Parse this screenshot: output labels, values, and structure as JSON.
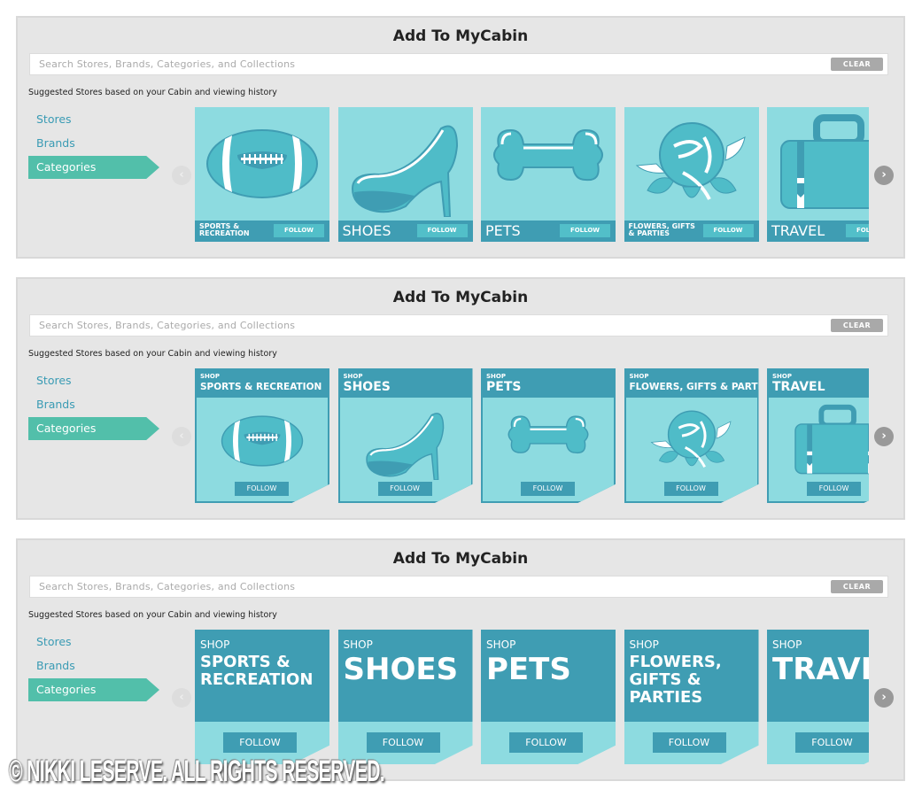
{
  "panels": [
    {
      "title": "Add To MyCabin",
      "search_placeholder": "Search Stores, Brands, Categories, and Collections",
      "clear_label": "CLEAR",
      "suggested": "Suggested Stores based on your Cabin and viewing history",
      "nav": [
        "Stores",
        "Brands",
        "Categories"
      ],
      "active_nav": "Categories",
      "variant": 1,
      "tiles": [
        {
          "name": "SPORTS & RECREATION",
          "follow": "FOLLOW",
          "icon": "football-icon"
        },
        {
          "name": "SHOES",
          "follow": "FOLLOW",
          "icon": "shoe-icon"
        },
        {
          "name": "PETS",
          "follow": "FOLLOW",
          "icon": "bone-icon"
        },
        {
          "name": "FLOWERS, GIFTS & PARTIES",
          "follow": "FOLLOW",
          "icon": "rose-icon"
        },
        {
          "name": "TRAVEL",
          "follow": "FOLLOW",
          "icon": "suitcase-icon"
        }
      ]
    },
    {
      "title": "Add To MyCabin",
      "search_placeholder": "Search Stores, Brands, Categories, and Collections",
      "clear_label": "CLEAR",
      "suggested": "Suggested Stores based on your Cabin and viewing history",
      "nav": [
        "Stores",
        "Brands",
        "Categories"
      ],
      "active_nav": "Categories",
      "variant": 2,
      "tiles": [
        {
          "shop": "SHOP",
          "name": "SPORTS & RECREATION",
          "follow": "FOLLOW",
          "icon": "football-icon"
        },
        {
          "shop": "SHOP",
          "name": "SHOES",
          "follow": "FOLLOW",
          "icon": "shoe-icon"
        },
        {
          "shop": "SHOP",
          "name": "PETS",
          "follow": "FOLLOW",
          "icon": "bone-icon"
        },
        {
          "shop": "SHOP",
          "name": "FLOWERS, GIFTS & PARTIES",
          "follow": "FOLLOW",
          "icon": "rose-icon"
        },
        {
          "shop": "SHOP",
          "name": "TRAVEL",
          "follow": "FOLLOW",
          "icon": "suitcase-icon"
        }
      ]
    },
    {
      "title": "Add To MyCabin",
      "search_placeholder": "Search Stores, Brands, Categories, and Collections",
      "clear_label": "CLEAR",
      "suggested": "Suggested Stores based on your Cabin and viewing history",
      "nav": [
        "Stores",
        "Brands",
        "Categories"
      ],
      "active_nav": "Categories",
      "variant": 3,
      "tiles": [
        {
          "shop": "SHOP",
          "name": "SPORTS & RECREATION",
          "follow": "FOLLOW"
        },
        {
          "shop": "SHOP",
          "name": "SHOES",
          "follow": "FOLLOW"
        },
        {
          "shop": "SHOP",
          "name": "PETS",
          "follow": "FOLLOW"
        },
        {
          "shop": "SHOP",
          "name": "FLOWERS, GIFTS & PARTIES",
          "follow": "FOLLOW"
        },
        {
          "shop": "SHOP",
          "name": "TRAVEL",
          "follow": "FOLLOW"
        }
      ]
    }
  ],
  "watermark": "© NIKKI LESERVE. ALL RIGHTS RESERVED.",
  "colors": {
    "panel_bg": "#e6e6e6",
    "accent_green": "#52bfaa",
    "tile_light": "#8ddbe0",
    "tile_mid": "#4fbcc8",
    "tile_dark": "#3f9db3",
    "nav_text": "#3a9bb4"
  }
}
